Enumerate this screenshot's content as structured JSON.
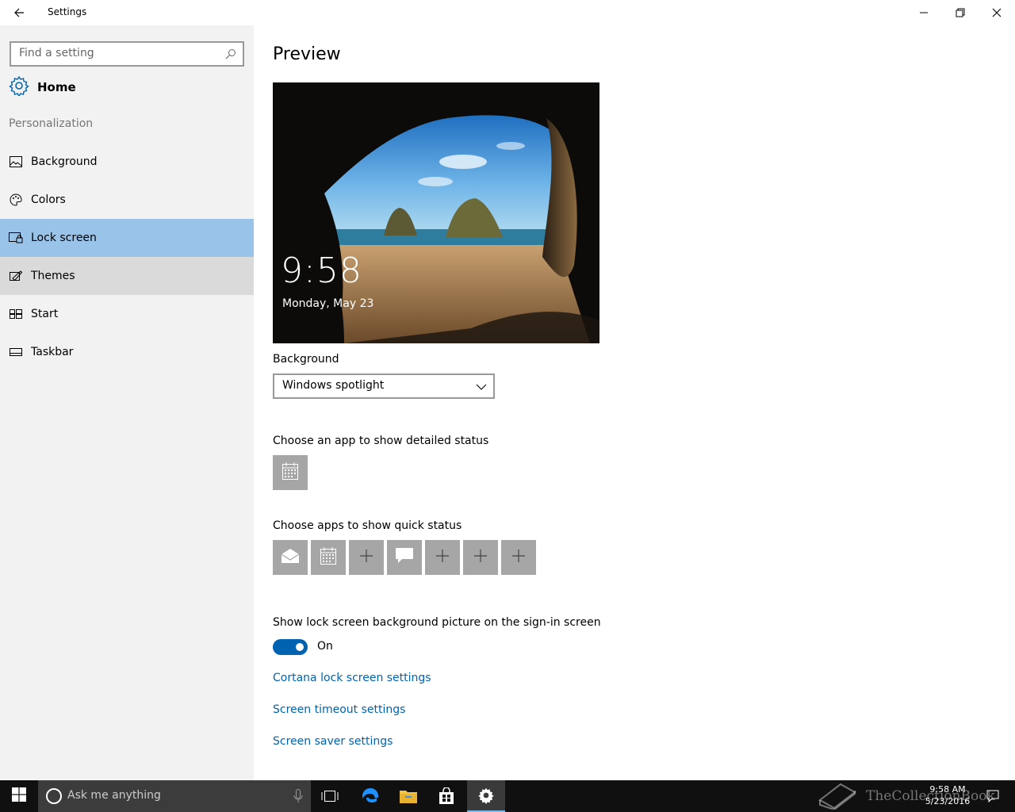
{
  "window": {
    "title": "Settings",
    "back_icon": "back-arrow-icon",
    "minimize_icon": "minimize-icon",
    "restore_icon": "restore-icon",
    "close_icon": "close-icon"
  },
  "sidebar": {
    "search_placeholder": "Find a setting",
    "home_label": "Home",
    "section_label": "Personalization",
    "items": [
      {
        "label": "Background",
        "icon": "picture-icon",
        "state": "normal"
      },
      {
        "label": "Colors",
        "icon": "palette-icon",
        "state": "normal"
      },
      {
        "label": "Lock screen",
        "icon": "lock-screen-icon",
        "state": "selected"
      },
      {
        "label": "Themes",
        "icon": "themes-icon",
        "state": "hover"
      },
      {
        "label": "Start",
        "icon": "start-icon",
        "state": "normal"
      },
      {
        "label": "Taskbar",
        "icon": "taskbar-icon",
        "state": "normal"
      }
    ]
  },
  "main": {
    "preview_heading": "Preview",
    "preview_time": "9:58",
    "preview_date": "Monday, May 23",
    "background_label": "Background",
    "background_value": "Windows spotlight",
    "detailed_status_label": "Choose an app to show detailed status",
    "detailed_status_apps": [
      "calendar-icon"
    ],
    "quick_status_label": "Choose apps to show quick status",
    "quick_status_apps": [
      "mail-icon",
      "calendar-icon",
      "plus-icon",
      "message-icon",
      "plus-icon",
      "plus-icon",
      "plus-icon"
    ],
    "signin_label": "Show lock screen background picture on the sign-in screen",
    "signin_toggle": "On",
    "signin_toggle_on": true,
    "links": [
      "Cortana lock screen settings",
      "Screen timeout settings",
      "Screen saver settings"
    ]
  },
  "taskbar": {
    "search_placeholder": "Ask me anything",
    "apps": [
      "task-view-icon",
      "edge-icon",
      "file-explorer-icon",
      "store-icon",
      "settings-icon"
    ],
    "active_app": "settings-icon",
    "time": "9:58 AM",
    "date": "5/23/2016",
    "watermark": "TheCollectionBook"
  },
  "colors": {
    "accent": "#0063b1",
    "selected_nav": "#99c3e8",
    "hover_nav": "#dadada",
    "sidebar_bg": "#f2f2f2",
    "tile_bg": "#a6a6a6",
    "taskbar_bg": "#101010"
  }
}
